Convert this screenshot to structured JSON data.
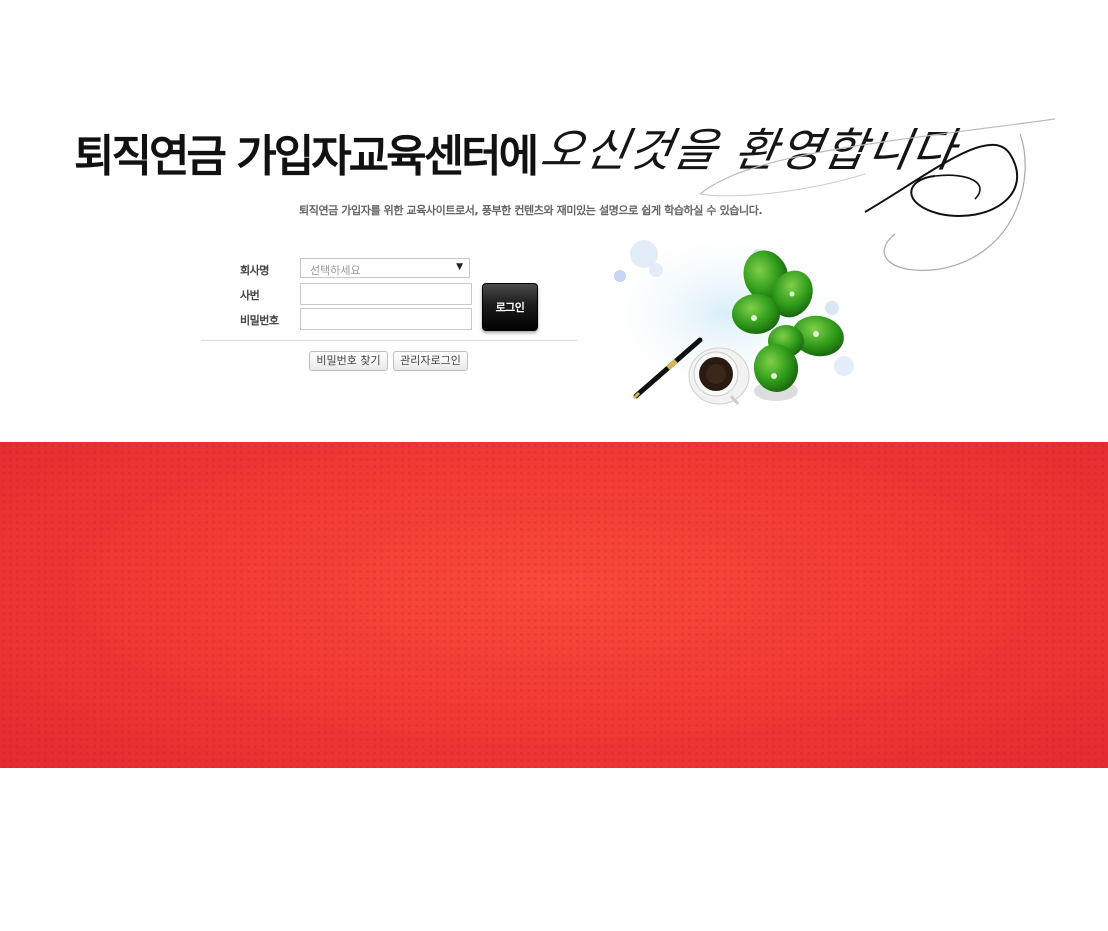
{
  "header": {
    "title_main": "퇴직연금 가입자교육센터에",
    "title_script": "오신것을 환영합니다",
    "subtitle": "퇴직연금 가입자를 위한 교육사이트로서, 풍부한 컨텐츠와 재미있는 설명으로 쉽게 학습하실 수 있습니다."
  },
  "login": {
    "company_label": "회사명",
    "company_placeholder": "선택하세요",
    "employee_id_label": "사번",
    "password_label": "비밀번호",
    "login_button": "로그인",
    "find_password_button": "비밀번호 찾기",
    "admin_login_button": "관리자로그인"
  },
  "colors": {
    "banner": "#f13c34",
    "button_dark": "#1c1c1c"
  },
  "icons": [
    "swirl-decoration",
    "pen-icon",
    "coffee-cup-icon",
    "plant-icon",
    "caret-down-icon"
  ]
}
